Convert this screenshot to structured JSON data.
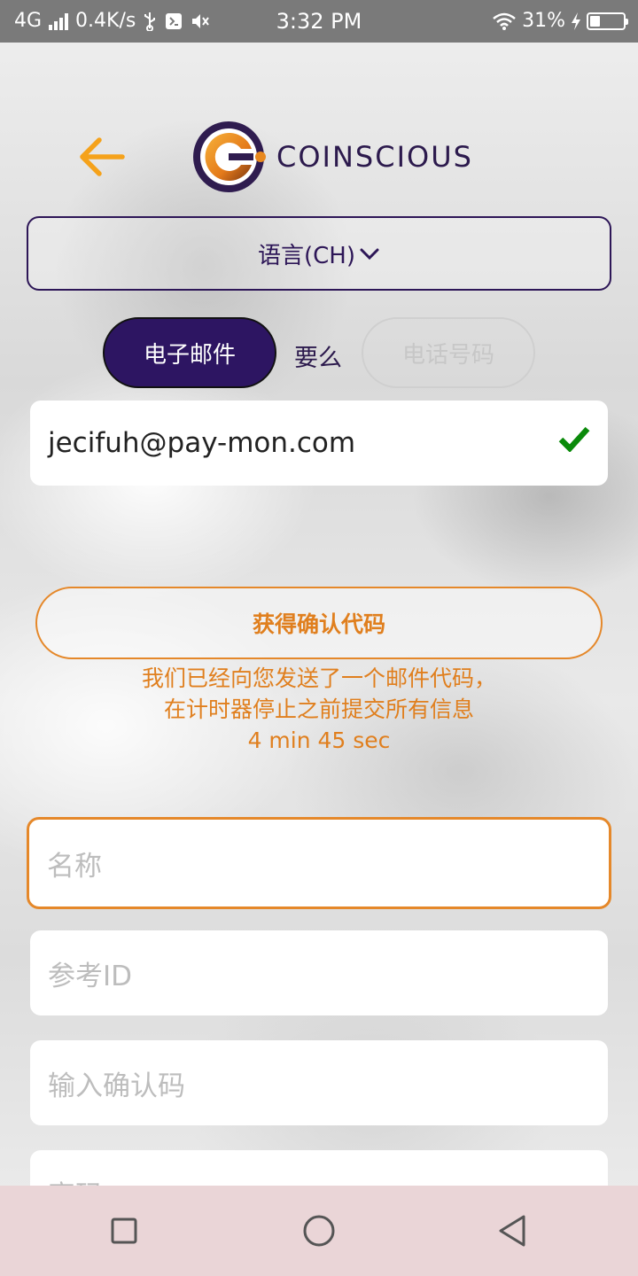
{
  "status_bar": {
    "network": "4G",
    "speed": "0.4K/s",
    "time": "3:32 PM",
    "battery_percent": "31%",
    "battery_level": 0.31
  },
  "header": {
    "back_icon": "arrow-left-icon",
    "logo_text": "COINSCIOUS",
    "accent_color": "#f5a21b",
    "brand_color": "#2d1562"
  },
  "language": {
    "label": "语言(CH)",
    "icon": "chevron-down-icon"
  },
  "contact_toggle": {
    "email_label": "电子邮件",
    "or_label": "要么",
    "phone_label": "电话号码",
    "selected": "email"
  },
  "email_field": {
    "value": "jecifuh@pay-mon.com",
    "status_icon": "checkmark-icon",
    "status_color": "#0a8a0a"
  },
  "verification": {
    "button_label": "获得确认代码",
    "info_line1": "我们已经向您发送了一个邮件代码，",
    "info_line2": "在计时器停止之前提交所有信息",
    "timer": "4 min 45 sec",
    "accent_color": "#e5882a"
  },
  "form": {
    "name_placeholder": "名称",
    "reference_placeholder": "参考ID",
    "code_placeholder": "输入确认码",
    "password_placeholder": "密码"
  },
  "nav_bar": {
    "recent_icon": "square-icon",
    "home_icon": "circle-icon",
    "back_icon": "triangle-back-icon"
  }
}
